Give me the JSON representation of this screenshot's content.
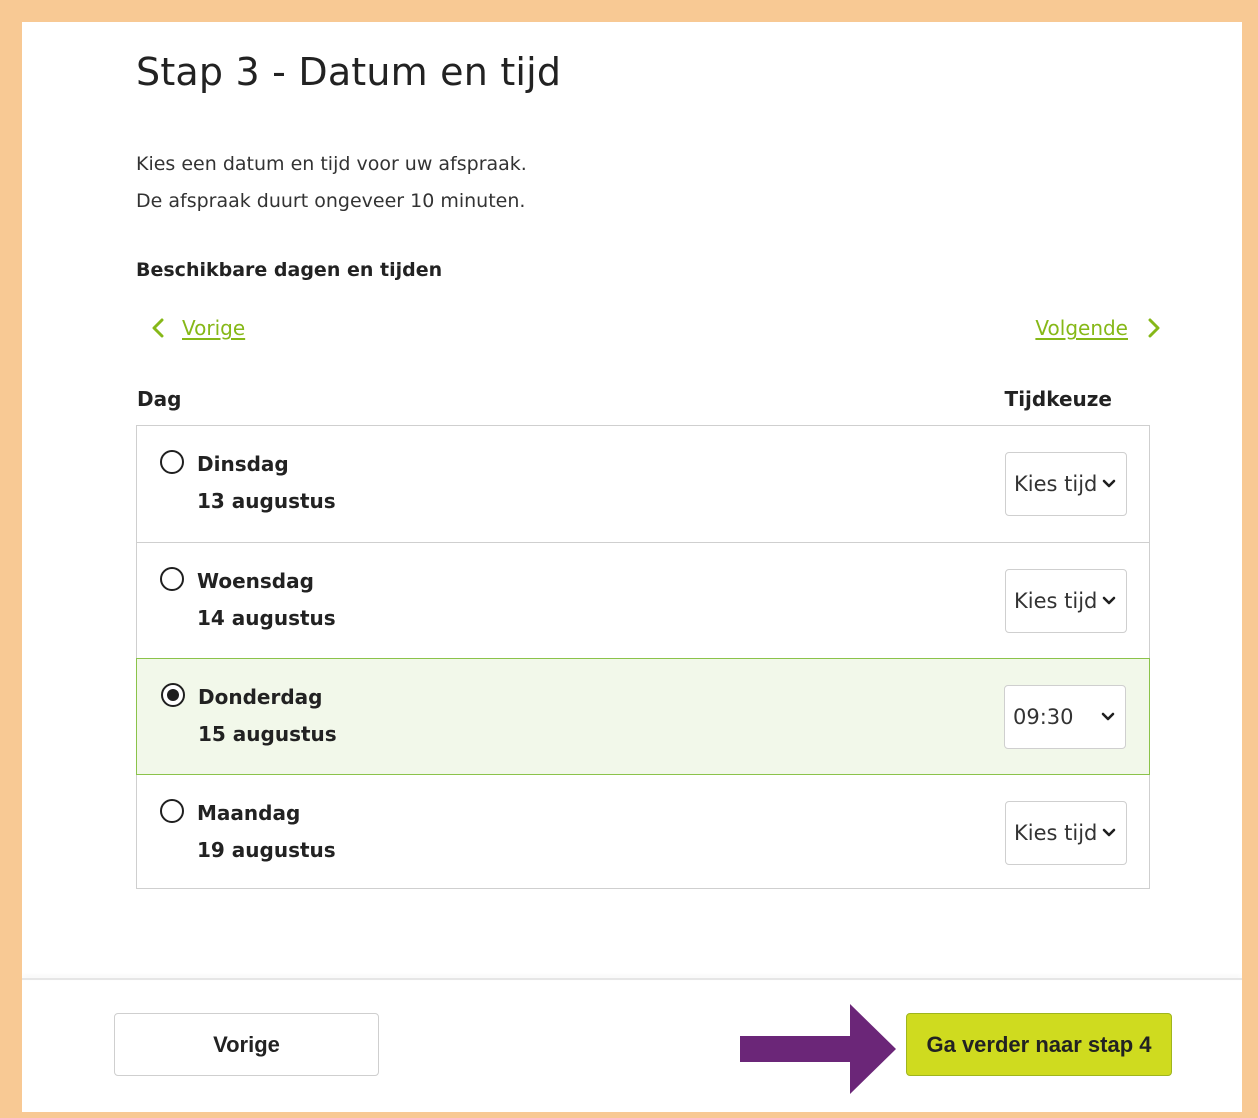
{
  "page": {
    "title": "Stap 3 - Datum en tijd",
    "intro_line1": "Kies een datum en tijd voor uw afspraak.",
    "intro_line2": "De afspraak duurt ongeveer 10 minuten.",
    "section_heading": "Beschikbare dagen en tijden"
  },
  "navigation": {
    "prev_label": "Vorige",
    "next_label": "Volgende"
  },
  "table": {
    "col_day": "Dag",
    "col_time": "Tijdkeuze",
    "rows": [
      {
        "day": "Dinsdag",
        "date": "13 augustus",
        "time": "Kies tijd",
        "selected": false
      },
      {
        "day": "Woensdag",
        "date": "14 augustus",
        "time": "Kies tijd",
        "selected": false
      },
      {
        "day": "Donderdag",
        "date": "15 augustus",
        "time": "09:30",
        "selected": true
      },
      {
        "day": "Maandag",
        "date": "19 augustus",
        "time": "Kies tijd",
        "selected": false
      }
    ]
  },
  "footer": {
    "prev_button": "Vorige",
    "next_button": "Ga verder naar stap 4"
  },
  "colors": {
    "frame_border": "#f8c994",
    "accent_green": "#86b818",
    "selected_row_bg": "#f2f8ea",
    "selected_row_border": "#8bc34a",
    "primary_button": "#cfdb1f",
    "annotation_arrow": "#6b2678"
  },
  "icons": {
    "nav_prev": "chevron-left-icon",
    "nav_next": "chevron-right-icon",
    "select": "chevron-down-icon",
    "annotation": "arrow-right-icon"
  }
}
